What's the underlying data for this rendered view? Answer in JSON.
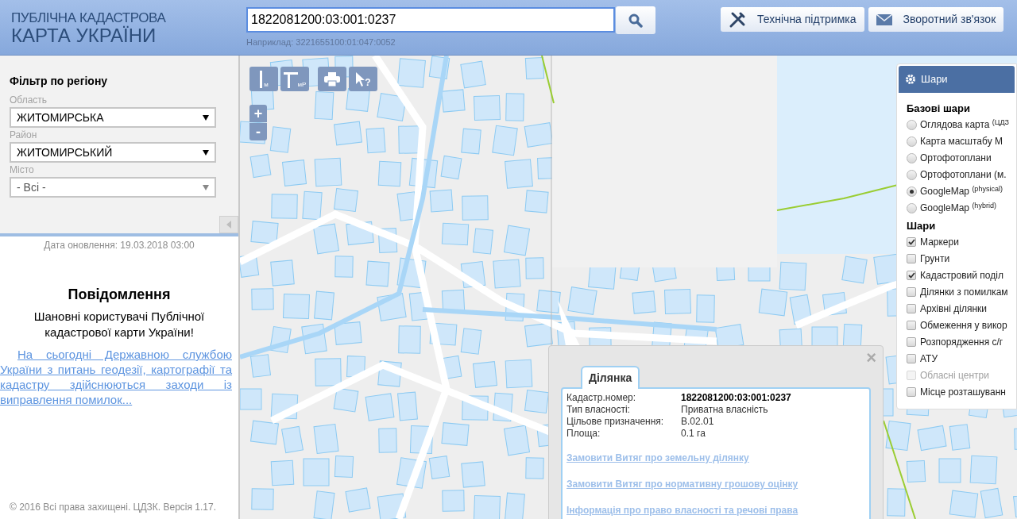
{
  "logo": {
    "line_1": "ПУБЛІЧНА КАДАСТРОВА",
    "line_2": "КАРТА УКРАЇНИ"
  },
  "search": {
    "value": "1822081200:03:001:0237",
    "example": "Наприклад: 3221655100:01:047:0052"
  },
  "header_buttons": [
    {
      "kind": "support",
      "label": "Технічна підтримка"
    },
    {
      "kind": "feedback",
      "label": "Зворотний зв'язок"
    }
  ],
  "filter": {
    "title": "Фільтр по регіону",
    "fields": [
      {
        "label": "Область",
        "value": "ЖИТОМИРСЬКА",
        "disabled": false
      },
      {
        "label": "Район",
        "value": "ЖИТОМИРСЬКИЙ",
        "disabled": false
      },
      {
        "label": "Місто",
        "value": "- Всі -",
        "disabled": true
      }
    ]
  },
  "update_date": "Дата оновлення: 19.03.2018 03:00",
  "notice": {
    "title": "Повідомлення",
    "greeting": "Шановні користувачі Публічної кадастрової карти України!",
    "link": "На сьогодні Державною службою України з питань геодезії, картографії та кадастру здійснюються заходи із виправлення помилок..."
  },
  "copyright": "© 2016 Всі права захищені. ЦДЗК. Версія 1.17.",
  "map_tools": [
    {
      "kind": "measure-line",
      "label": "м"
    },
    {
      "kind": "measure-area",
      "label": "мР"
    },
    {
      "kind": "print"
    },
    {
      "kind": "identify",
      "label": "?"
    }
  ],
  "zoom": {
    "in": "+",
    "out": "-"
  },
  "layers": {
    "title": "Шари",
    "base_title": "Базові шари",
    "base": [
      {
        "label": "Оглядова карта $^{(ЦДЗ}$",
        "selected": false
      },
      {
        "label": "Карта масштабу М",
        "selected": false
      },
      {
        "label": "Ортофотоплани",
        "selected": false
      },
      {
        "label": "Ортофотоплани (м.",
        "selected": false
      },
      {
        "label": "GoogleMap $^{(physical)}$",
        "selected": true
      },
      {
        "label": "GoogleMap $^{(hybrid)}$",
        "selected": false
      }
    ],
    "overlay_title": "Шари",
    "overlays": [
      {
        "label": "Маркери",
        "checked": true,
        "disabled": false
      },
      {
        "label": "Грунти",
        "checked": false,
        "disabled": false
      },
      {
        "label": "Кадастровий поділ",
        "checked": true,
        "disabled": false
      },
      {
        "label": "Ділянки з помилкам",
        "checked": false,
        "disabled": false
      },
      {
        "label": "Архівні ділянки",
        "checked": false,
        "disabled": false
      },
      {
        "label": "Обмеження у викор",
        "checked": false,
        "disabled": false
      },
      {
        "label": "Розпорядження с/г",
        "checked": false,
        "disabled": false
      },
      {
        "label": "АТУ",
        "checked": false,
        "disabled": false
      },
      {
        "label": "Обласні центри",
        "checked": false,
        "disabled": true
      },
      {
        "label": "Місце розташуванн",
        "checked": false,
        "disabled": false
      }
    ]
  },
  "popup": {
    "tab": "Ділянка",
    "close": "×",
    "rows": [
      {
        "label": "Кадастр.номер:",
        "value": "1822081200:03:001:0237",
        "bold": true
      },
      {
        "label": "Тип власності:",
        "value": "Приватна власність",
        "bold": false
      },
      {
        "label": "Цільове призначення:",
        "value": "В.02.01",
        "bold": false
      },
      {
        "label": "Площа:",
        "value": "0.1 га",
        "bold": false
      }
    ],
    "links": [
      "Замовити Витяг про земельну ділянку",
      "Замовити Витяг про нормативну грошову оцінку",
      "Інформація про право власності та речові права"
    ]
  }
}
